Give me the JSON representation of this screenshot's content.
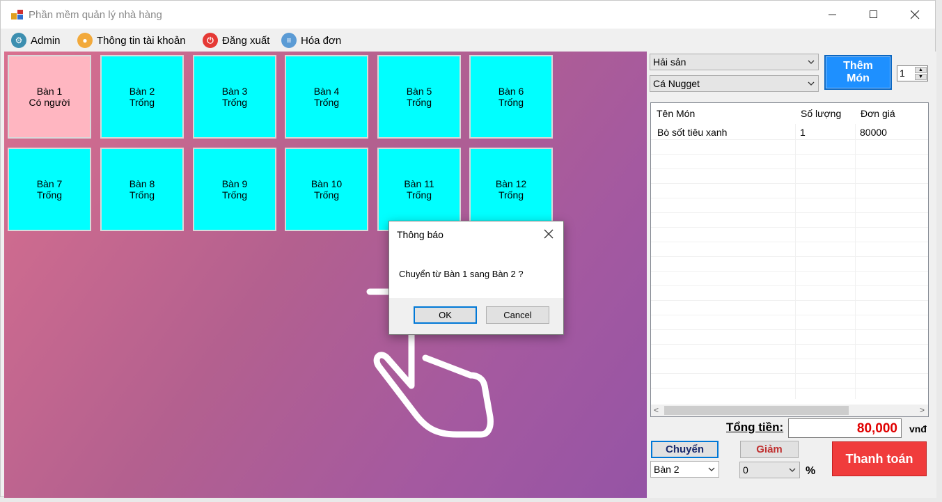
{
  "window": {
    "title": "Phần mềm quản lý nhà hàng"
  },
  "menu": [
    {
      "label": "Admin",
      "icon": "admin-icon"
    },
    {
      "label": "Thông tin tài khoản",
      "icon": "account-icon"
    },
    {
      "label": "Đăng xuất",
      "icon": "power-icon"
    },
    {
      "label": "Hóa đơn",
      "icon": "invoice-icon"
    }
  ],
  "tables": [
    {
      "name": "Bàn 1",
      "status": "Có người",
      "occupied": true
    },
    {
      "name": "Bàn 2",
      "status": "Trống",
      "occupied": false
    },
    {
      "name": "Bàn 3",
      "status": "Trống",
      "occupied": false
    },
    {
      "name": "Bàn 4",
      "status": "Trống",
      "occupied": false
    },
    {
      "name": "Bàn 5",
      "status": "Trống",
      "occupied": false
    },
    {
      "name": "Bàn 6",
      "status": "Trống",
      "occupied": false
    },
    {
      "name": "Bàn 7",
      "status": "Trống",
      "occupied": false
    },
    {
      "name": "Bàn 8",
      "status": "Trống",
      "occupied": false
    },
    {
      "name": "Bàn 9",
      "status": "Trống",
      "occupied": false
    },
    {
      "name": "Bàn 10",
      "status": "Trống",
      "occupied": false
    },
    {
      "name": "Bàn 11",
      "status": "Trống",
      "occupied": false
    },
    {
      "name": "Bàn 12",
      "status": "Trống",
      "occupied": false
    }
  ],
  "order": {
    "category": "Hải sản",
    "food": "Cá Nugget",
    "add_button": [
      "Thêm",
      "Món"
    ],
    "quantity": "1",
    "columns": [
      "Tên Món",
      "Số lượng",
      "Đơn giá"
    ],
    "rows": [
      [
        "Bò sốt tiêu xanh",
        "1",
        "80000"
      ]
    ],
    "total_label": "Tổng tiền:",
    "total_value": "80,000",
    "currency": "vnđ",
    "switch_button": "Chuyển",
    "switch_target": "Bàn 2",
    "discount_button": "Giảm",
    "discount_value": "0",
    "percent": "%",
    "pay_button": "Thanh toán"
  },
  "dialog": {
    "title": "Thông báo",
    "message": "Chuyển từ Bàn 1 sang Bàn 2 ?",
    "ok": "OK",
    "cancel": "Cancel"
  },
  "colors": {
    "table_empty": "#00ffff",
    "table_occupied": "#ffb6c1",
    "accent": "#1e90ff",
    "pay": "#f03c3c",
    "total": "#e00000"
  }
}
